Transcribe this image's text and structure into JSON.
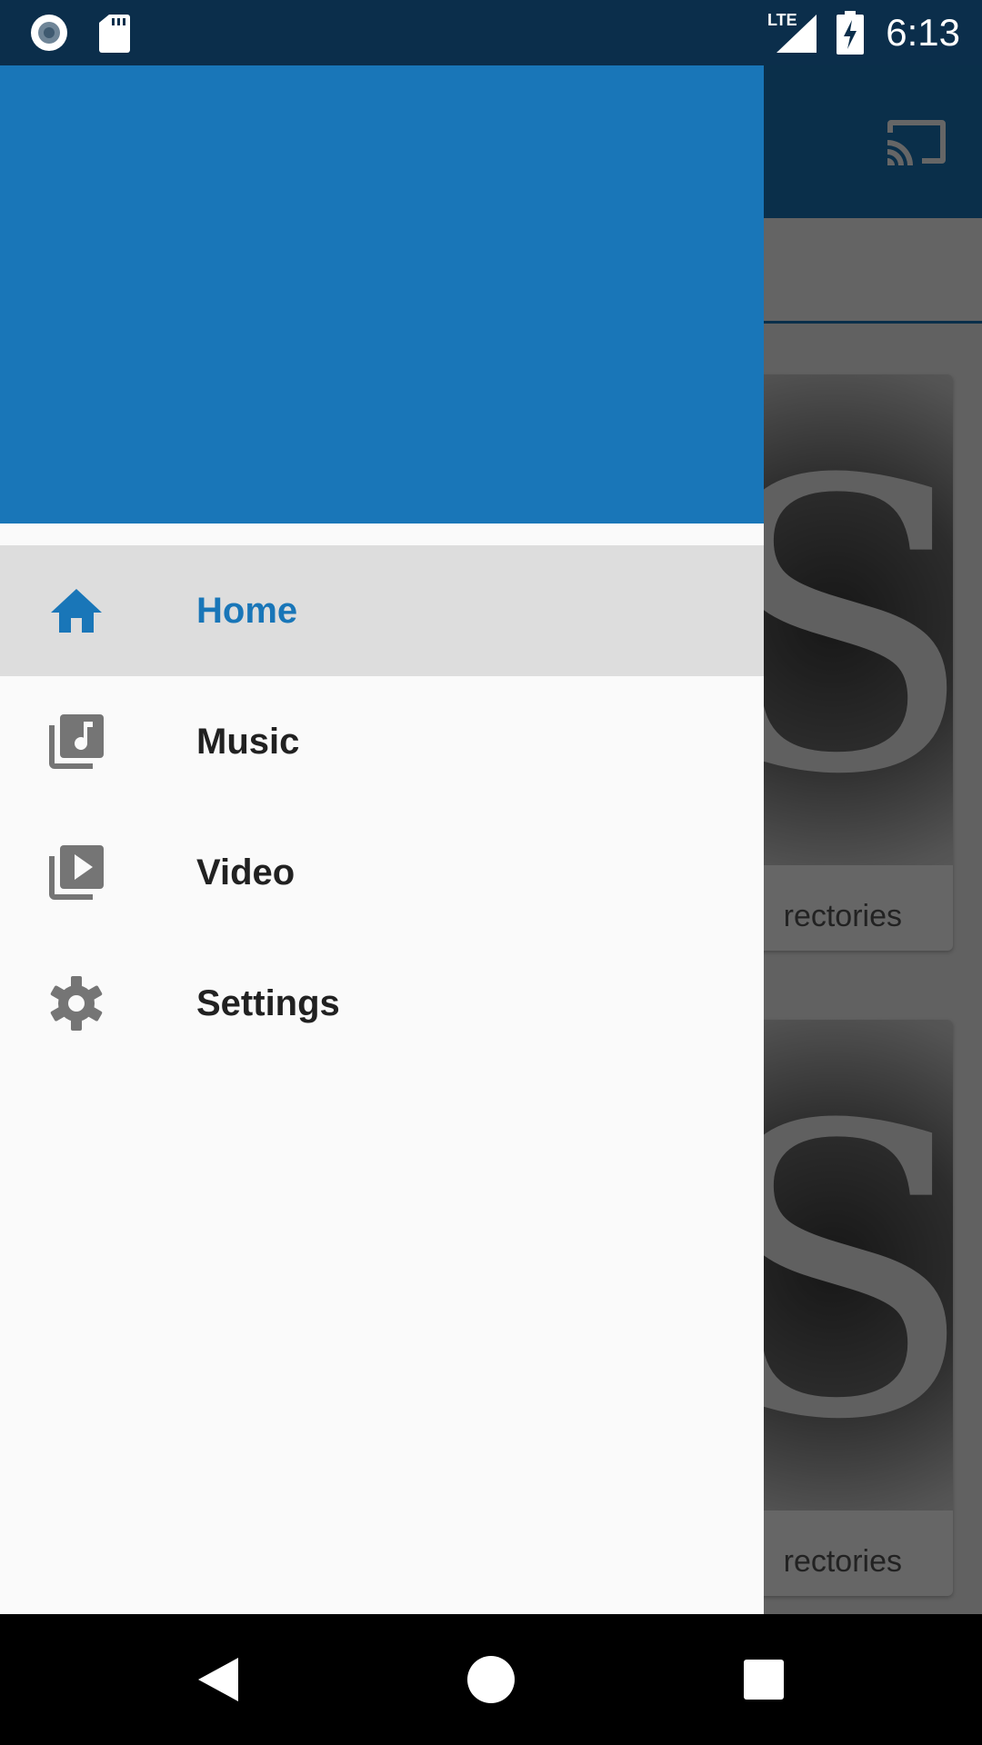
{
  "status_bar": {
    "time": "6:13",
    "network": "LTE",
    "icons": [
      "record-icon",
      "sd-card-icon",
      "lte-signal-icon",
      "battery-charging-icon"
    ]
  },
  "background_app": {
    "cast_icon": "cast-icon",
    "cards": [
      {
        "letter": "S",
        "caption": "rectories"
      },
      {
        "letter": "S",
        "caption": "rectories"
      }
    ]
  },
  "drawer": {
    "items": [
      {
        "label": "Home",
        "icon": "home-icon",
        "active": true
      },
      {
        "label": "Music",
        "icon": "music-library-icon",
        "active": false
      },
      {
        "label": "Video",
        "icon": "video-library-icon",
        "active": false
      },
      {
        "label": "Settings",
        "icon": "gear-icon",
        "active": false
      }
    ]
  },
  "colors": {
    "primary": "#1976b8",
    "status_bar": "#0b2e4b",
    "active_item_bg": "#dddddd",
    "drawer_bg": "#fafafa",
    "icon_grey": "#757575"
  },
  "nav_bar": {
    "buttons": [
      "back-icon",
      "home-circle-icon",
      "recents-icon"
    ]
  }
}
